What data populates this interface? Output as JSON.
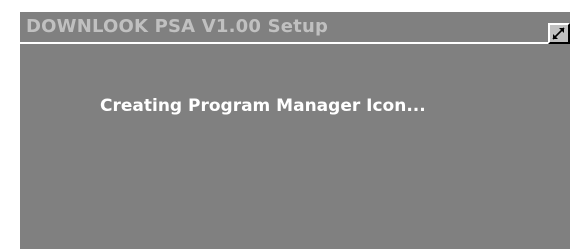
{
  "window": {
    "title": "DOWNLOOK PSA V1.00 Setup",
    "status_message": "Creating Program Manager Icon..."
  },
  "titlebar": {
    "restore_icon": "restore-icon"
  },
  "colors": {
    "window_bg": "#808080",
    "title_text": "#c0c0c0",
    "status_text": "#ffffff",
    "button_face": "#c0c0c0"
  }
}
